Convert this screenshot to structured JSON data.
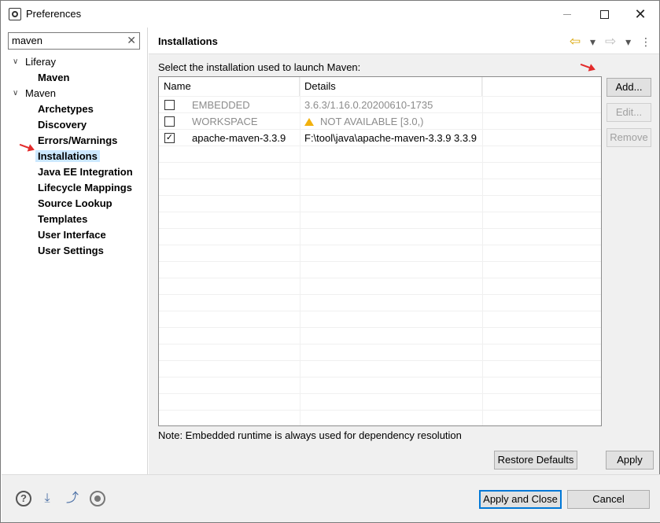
{
  "window": {
    "title": "Preferences"
  },
  "filter": {
    "value": "maven"
  },
  "tree": {
    "groups": [
      {
        "label": "Liferay",
        "children": [
          "Maven"
        ]
      },
      {
        "label": "Maven",
        "children": [
          "Archetypes",
          "Discovery",
          "Errors/Warnings",
          "Installations",
          "Java EE Integration",
          "Lifecycle Mappings",
          "Source Lookup",
          "Templates",
          "User Interface",
          "User Settings"
        ]
      }
    ],
    "selected": "Installations"
  },
  "page": {
    "title": "Installations",
    "instruction": "Select the installation used to launch Maven:",
    "note": "Note: Embedded runtime is always used for dependency resolution"
  },
  "table": {
    "columns": [
      "Name",
      "Details"
    ],
    "rows": [
      {
        "checked": false,
        "name": "EMBEDDED",
        "details": "3.6.3/1.16.0.20200610-1735",
        "disabled": true,
        "warning": false
      },
      {
        "checked": false,
        "name": "WORKSPACE",
        "details": "NOT AVAILABLE [3.0,)",
        "disabled": true,
        "warning": true
      },
      {
        "checked": true,
        "name": "apache-maven-3.3.9",
        "details": "F:\\tool\\java\\apache-maven-3.3.9 3.3.9",
        "disabled": false,
        "warning": false
      }
    ]
  },
  "buttons": {
    "add": "Add...",
    "edit": "Edit...",
    "remove": "Remove",
    "restore_defaults": "Restore Defaults",
    "apply": "Apply",
    "apply_close": "Apply and Close",
    "cancel": "Cancel"
  },
  "colors": {
    "selection": "#cce8ff",
    "annotation_arrow": "#e32b2b",
    "default_button_border": "#0078d7"
  }
}
